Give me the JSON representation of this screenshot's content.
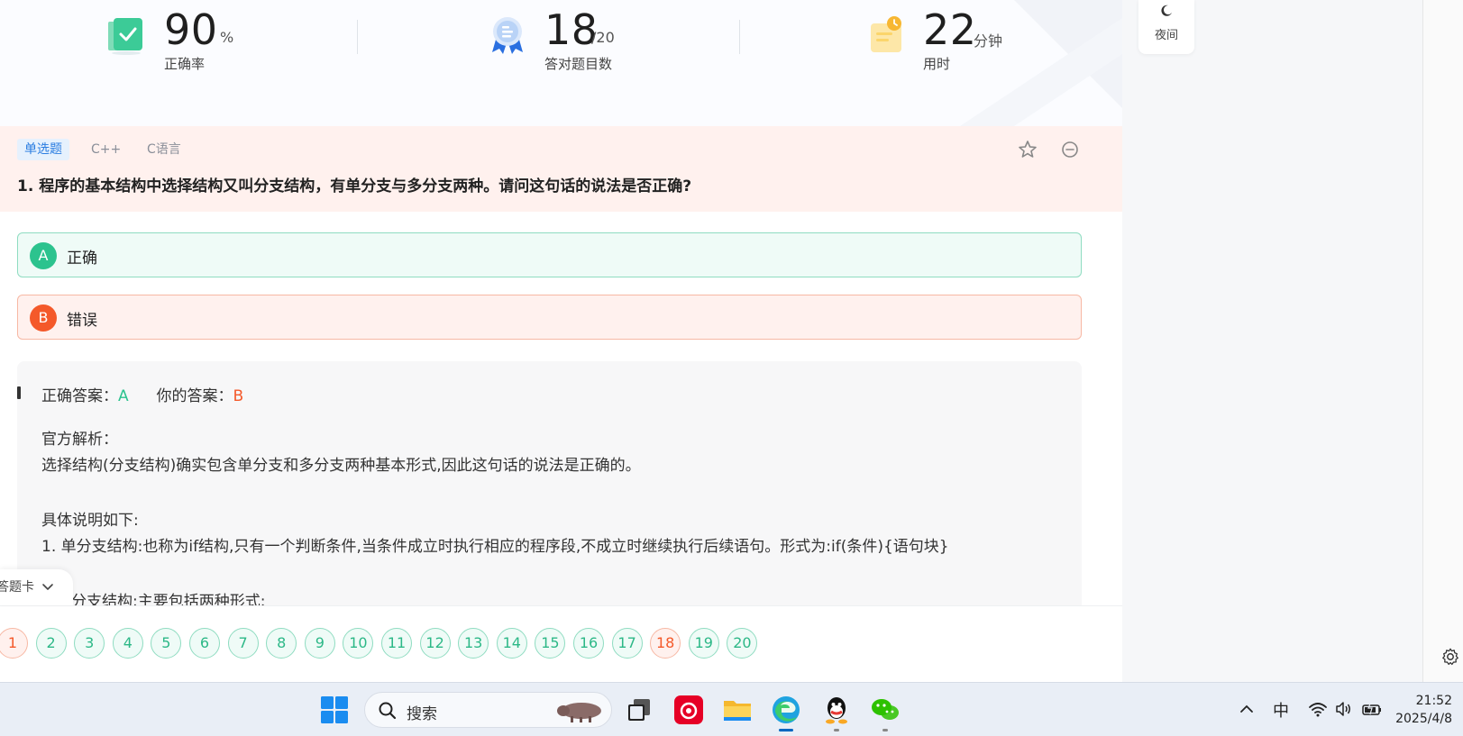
{
  "stats": {
    "accuracy": {
      "value": "90",
      "unit": "%",
      "label": "正确率"
    },
    "correct": {
      "value": "18",
      "unit": "/20",
      "label": "答对题目数"
    },
    "time": {
      "value": "22",
      "unit": "分钟",
      "label": "用时"
    }
  },
  "question": {
    "tags": [
      "单选题",
      "C++",
      "C语言"
    ],
    "title": "1. 程序的基本结构中选择结构又叫分支结构，有单分支与多分支两种。请问这句话的说法是否正确?",
    "options": [
      {
        "letter": "A",
        "text": "正确"
      },
      {
        "letter": "B",
        "text": "错误"
      }
    ]
  },
  "analysis": {
    "correct_label": "正确答案：",
    "correct_value": "A",
    "yours_label": "你的答案：",
    "yours_value": "B",
    "heading": "官方解析：",
    "line1": "选择结构(分支结构)确实包含单分支和多分支两种基本形式,因此这句话的说法是正确的。",
    "heading2": "具体说明如下:",
    "line2": "1. 单分支结构:也称为if结构,只有一个判断条件,当条件成立时执行相应的程序段,不成立时继续执行后续语句。形式为:if(条件){语句块}",
    "line3_partial": "分支结构:主要包括两种形式:"
  },
  "answer_card": {
    "label": "答题卡"
  },
  "numbers": [
    "1",
    "2",
    "3",
    "4",
    "5",
    "6",
    "7",
    "8",
    "9",
    "10",
    "11",
    "12",
    "13",
    "14",
    "15",
    "16",
    "17",
    "18",
    "19",
    "20"
  ],
  "wrong_numbers": [
    "1",
    "18"
  ],
  "sidebar": {
    "night_label": "夜间"
  },
  "taskbar": {
    "search_label": "搜索",
    "ime": "中",
    "time": "21:52",
    "date": "2025/4/8"
  },
  "colors": {
    "correct": "#2cc38e",
    "wrong": "#f4592a",
    "tag_blue": "#2b7de1"
  }
}
